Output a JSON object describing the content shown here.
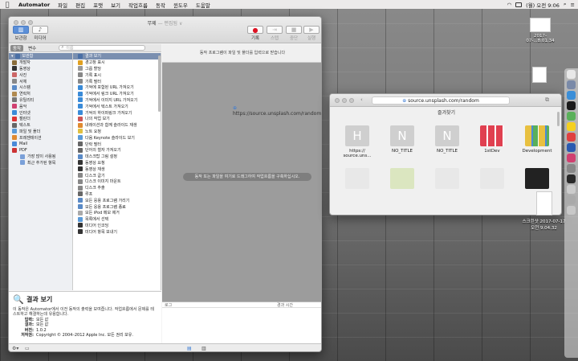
{
  "menubar": {
    "app": "Automator",
    "items": [
      "파일",
      "편집",
      "포맷",
      "보기",
      "작업흐름",
      "동작",
      "윈도우",
      "도움말"
    ],
    "clock": "(월) 오전 9:06"
  },
  "window": {
    "title": "무제",
    "subtitle": "— 편집됨 ∨",
    "toolbar": {
      "library": "보관함",
      "media": "미디어",
      "record": "기록",
      "step": "스텝",
      "stop": "중단",
      "run": "실행"
    },
    "tabs": {
      "actions": "동작",
      "variables": "변수"
    },
    "search_placeholder": "이름",
    "library": [
      {
        "label": "보관함",
        "kind": "hdr",
        "color": "#4a6fa5"
      },
      {
        "label": "개발자",
        "color": "#8a6d3b"
      },
      {
        "label": "동영상",
        "color": "#333"
      },
      {
        "label": "사진",
        "color": "#c66"
      },
      {
        "label": "서체",
        "color": "#888"
      },
      {
        "label": "시스템",
        "color": "#5a8ac6"
      },
      {
        "label": "연락처",
        "color": "#b08a50"
      },
      {
        "label": "유틸리티",
        "color": "#777"
      },
      {
        "label": "음악",
        "color": "#d04070"
      },
      {
        "label": "인터넷",
        "color": "#3a8bd8"
      },
      {
        "label": "캘린더",
        "color": "#d33"
      },
      {
        "label": "텍스트",
        "color": "#666"
      },
      {
        "label": "파일 및 폴더",
        "color": "#5a9ad8"
      },
      {
        "label": "프레젠테이션",
        "color": "#e08a30"
      },
      {
        "label": "Mail",
        "color": "#4a8ad8"
      },
      {
        "label": "PDF",
        "color": "#c33"
      },
      {
        "label": "가장 많이 사용됨",
        "kind": "ind",
        "color": "#7aa0d8"
      },
      {
        "label": "최근 추가된 항목",
        "kind": "ind",
        "color": "#7aa0d8"
      }
    ],
    "actions": [
      {
        "label": "결과 보기",
        "color": "#4a6fa5"
      },
      {
        "label": "경고창 표시",
        "color": "#e0a020"
      },
      {
        "label": "그룹 할당",
        "color": "#999"
      },
      {
        "label": "기록 표시",
        "color": "#888"
      },
      {
        "label": "기록 필터",
        "color": "#888"
      },
      {
        "label": "기억에 포함된 URL 가져오기",
        "color": "#3a8bd8"
      },
      {
        "label": "기억에서 링크 URL 가져오기",
        "color": "#3a8bd8"
      },
      {
        "label": "기억에서 이미지 URL 가져오기",
        "color": "#3a8bd8"
      },
      {
        "label": "기억에서 텍스트 가져오기",
        "color": "#3a8bd8"
      },
      {
        "label": "기억의 하이퍼링크 가져오기",
        "color": "#3a8bd8"
      },
      {
        "label": "나의 작업 보기",
        "color": "#c55"
      },
      {
        "label": "내레이션과 함께 슬라이드 재생",
        "color": "#e08a30"
      },
      {
        "label": "노트 요청",
        "color": "#e0c040"
      },
      {
        "label": "다음 Keynote 슬라이드 보기",
        "color": "#5a9ad8"
      },
      {
        "label": "단락 필터",
        "color": "#666"
      },
      {
        "label": "단어의 철자 가져오기",
        "color": "#666"
      },
      {
        "label": "데스크탑 그림 설정",
        "color": "#5a8ac6"
      },
      {
        "label": "동영상 요청",
        "color": "#333"
      },
      {
        "label": "동영상 재생",
        "color": "#333"
      },
      {
        "label": "디스크 굽기",
        "color": "#888"
      },
      {
        "label": "디스크 이미지 마운트",
        "color": "#888"
      },
      {
        "label": "디스크 추출",
        "color": "#888"
      },
      {
        "label": "루프",
        "color": "#666"
      },
      {
        "label": "모든 응용 프로그램 가리기",
        "color": "#5a8ac6"
      },
      {
        "label": "모든 응용 프로그램 종료",
        "color": "#5a8ac6"
      },
      {
        "label": "모든 iPod 메모 제거",
        "color": "#aaa"
      },
      {
        "label": "목록에서 선택",
        "color": "#5a9ad8"
      },
      {
        "label": "미디어 인코딩",
        "color": "#333"
      },
      {
        "label": "미디어 항목 보내기",
        "color": "#333"
      }
    ],
    "description": {
      "title": "결과 보기",
      "body": "이 동작은 Automator에서 이전 동작의 출력을 보여줍니다. 작업흐름에서 문제를 테스트하고 해결하는데 유용합니다.",
      "rows": [
        {
          "k": "입력:",
          "v": "모든 값"
        },
        {
          "k": "결과:",
          "v": "모든 값"
        },
        {
          "k": "버전:",
          "v": "1.0.2"
        },
        {
          "k": "저작권:",
          "v": "Copyright © 2004–2012 Apple Inc. 모든 권리 보유."
        }
      ]
    },
    "workflow": {
      "receives": "동작 프로그램이 파일 및 폴더를 입력으로 받습니다",
      "hint": "동작 또는 파일을 여기로 드래그하여 작업흐름을 구축하십시오.",
      "drag_url": "https://source.unsplash.com/random"
    },
    "log": {
      "col1": "로그",
      "col2": "경과 시간"
    }
  },
  "safari": {
    "url": "source.unsplash.com/random",
    "favorites": "즐겨찾기",
    "tiles": [
      {
        "letter": "H",
        "label": "https://\nsource.uns..."
      },
      {
        "letter": "N",
        "label": "NO_TITLE"
      },
      {
        "letter": "N",
        "label": "NO_TITLE"
      },
      {
        "letter": "",
        "label": "1stDev"
      },
      {
        "letter": "",
        "label": "Development"
      }
    ]
  },
  "desktop": {
    "file1": "스크린샷 2017-07-17\n오전 9.04.32",
    "file_top": "2017-07-...8.01.34"
  }
}
